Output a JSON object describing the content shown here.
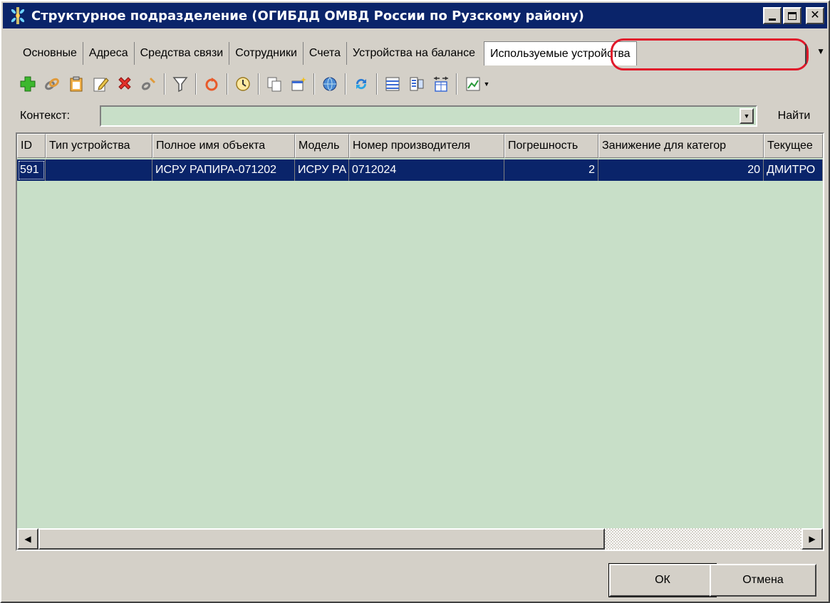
{
  "window": {
    "title": "Структурное подразделение (ОГИБДД ОМВД России по Рузскому району)"
  },
  "tabs": [
    {
      "label": "Основные"
    },
    {
      "label": "Адреса"
    },
    {
      "label": "Средства связи"
    },
    {
      "label": "Сотрудники"
    },
    {
      "label": "Счета"
    },
    {
      "label": "Устройства на балансе"
    },
    {
      "label": "Используемые устройства",
      "active": true
    }
  ],
  "context": {
    "label": "Контекст:",
    "value": "",
    "find_label": "Найти"
  },
  "table": {
    "columns": [
      "ID",
      "Тип устройства",
      "Полное имя объекта",
      "Модель",
      "Номер производителя",
      "Погрешность",
      "Занижение для категор",
      "Текущее"
    ],
    "rows": [
      [
        "591",
        "",
        "ИСРУ РАПИРА-071202",
        "ИСРУ РА",
        "0712024",
        "2",
        "20",
        "ДМИТРО"
      ]
    ]
  },
  "buttons": {
    "ok": "ОК",
    "cancel": "Отмена"
  },
  "colors": {
    "title_bar": "#0a246a",
    "grid_background": "#c8dfc8",
    "selection": "#0a246a",
    "highlight_ring": "#e0182a"
  }
}
